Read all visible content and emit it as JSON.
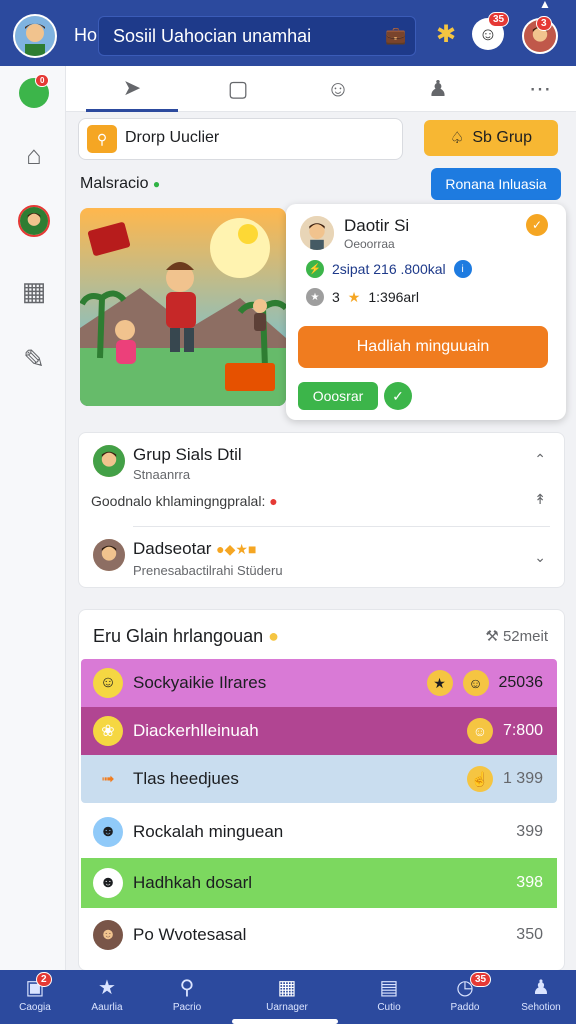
{
  "topbar": {
    "ho_label": "Ho",
    "search_value": "Sosiil Uahocian unamhai",
    "notif_badge": "35"
  },
  "tabs": [
    {
      "icon": "send-icon"
    },
    {
      "icon": "message-icon"
    },
    {
      "icon": "smile-icon"
    },
    {
      "icon": "people-icon"
    },
    {
      "icon": "more-icon"
    }
  ],
  "search_row": {
    "placeholder": "Drorp Uuclier",
    "group_button": "Sb Grup"
  },
  "section": {
    "label": "Malsracio",
    "action_button": "Ronana Inluasia"
  },
  "popup": {
    "name": "Daotir Si",
    "subtitle": "Oeoorraa",
    "stat1": "2sipat  216 .800kal",
    "stat2": "3",
    "stat2_value": "1:396arl",
    "cta": "Hadliah minguuain",
    "secondary": "Ooosrar"
  },
  "group": {
    "title": "Grup Sials Dtil",
    "subtitle": "Stnaanrra",
    "line": "Goodnalo khlamingngpralal:",
    "item2_title": "Dadseotar",
    "item2_sub": "Prenesabactilrahi Stüderu"
  },
  "leaderboard": {
    "title": "Eru Glain hrlangouan",
    "meta": "52meit",
    "rows": [
      {
        "name": "Sockyaikie Ilrares",
        "value": "25036",
        "bg": "#d97ad6"
      },
      {
        "name": "Diackerhlleinuah",
        "value": "7:800",
        "bg": "#b14592"
      },
      {
        "name": "Tlas heedjues",
        "value": "1 399",
        "bg": "#c9ddef"
      },
      {
        "name": "Rockalah minguean",
        "value": "399",
        "bg": "#ffffff"
      },
      {
        "name": "Hadhkah dosarl",
        "value": "398",
        "bg": "#7cd85f"
      },
      {
        "name": "Po Wvotesasal",
        "value": "350",
        "bg": "#ffffff"
      }
    ]
  },
  "bottom_nav": [
    {
      "label": "Caogia",
      "badge": "2"
    },
    {
      "label": "Aaurlia"
    },
    {
      "label": "Pacrio"
    },
    {
      "label": "Uarnager"
    },
    {
      "label": "Cutio"
    },
    {
      "label": "Paddo",
      "badge": "35"
    },
    {
      "label": "Sehotion"
    }
  ],
  "colors": {
    "primary": "#2c4a9e",
    "accent_orange": "#f07c1f",
    "accent_green": "#3cb54a",
    "accent_blue": "#1e7be0",
    "accent_yellow": "#f7b733"
  }
}
